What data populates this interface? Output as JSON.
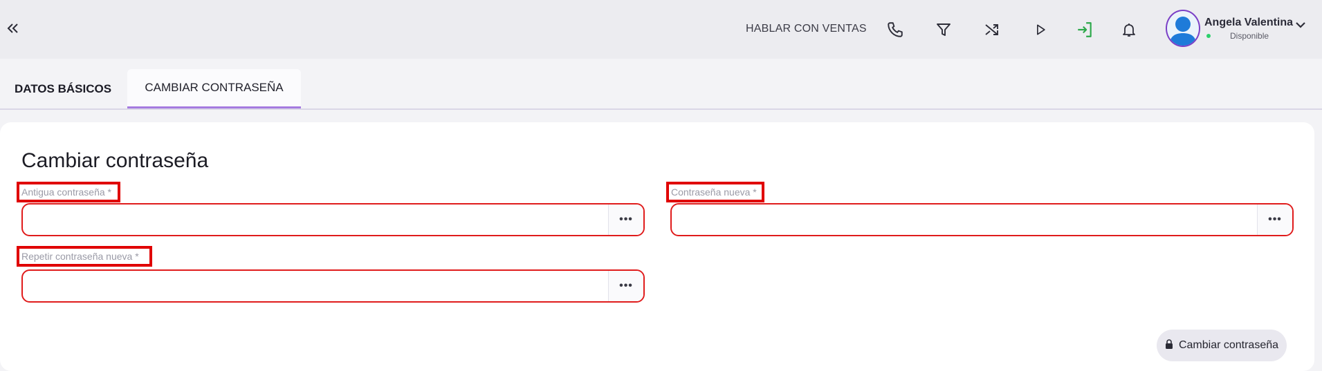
{
  "topbar": {
    "sales_link": "HABLAR CON VENTAS",
    "icons": [
      "phone-icon",
      "filter-icon",
      "shuffle-icon",
      "play-icon",
      "login-icon",
      "bell-icon"
    ],
    "accent": "#2ca84a"
  },
  "user": {
    "name": "Angela Valentina",
    "status": "Disponible",
    "status_color": "#2bd06b"
  },
  "tabs": [
    {
      "label": "DATOS BÁSICOS"
    },
    {
      "label": "CAMBIAR CONTRASEÑA",
      "active": true
    }
  ],
  "form": {
    "title": "Cambiar contraseña",
    "old_password": {
      "label": "Antigua contraseña *",
      "value": ""
    },
    "new_password": {
      "label": "Contraseña nueva *",
      "value": ""
    },
    "repeat_password": {
      "label": "Repetir contraseña nueva *",
      "value": ""
    },
    "reveal_glyph": "•••",
    "submit_label": "Cambiar contraseña",
    "error_color": "#e01b1b"
  }
}
